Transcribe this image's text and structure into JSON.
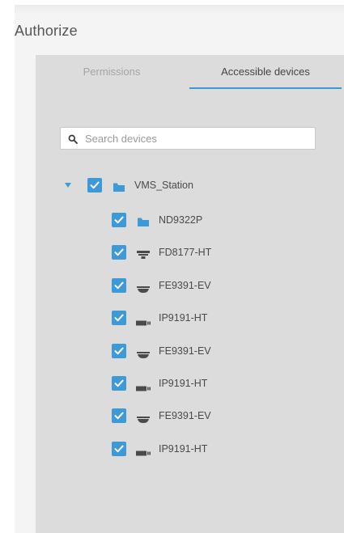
{
  "title": "Authorize",
  "tabs": {
    "permissions": "Permissions",
    "accessible_devices": "Accessible devices"
  },
  "search": {
    "placeholder": "Search devices",
    "value": ""
  },
  "colors": {
    "accent": "#3e9ad6",
    "panel": "#dcdcdc"
  },
  "tree": {
    "root": {
      "label": "VMS_Station",
      "icon": "folder-icon",
      "expanded": true,
      "checked": true
    },
    "children": [
      {
        "label": "ND9322P",
        "icon": "folder-icon",
        "checked": true
      },
      {
        "label": "FD8177-HT",
        "icon": "fixed-dome-camera-icon",
        "checked": true
      },
      {
        "label": "FE9391-EV",
        "icon": "fisheye-camera-icon",
        "checked": true
      },
      {
        "label": "IP9191-HT",
        "icon": "bullet-camera-icon",
        "checked": true
      },
      {
        "label": "FE9391-EV",
        "icon": "fisheye-camera-icon",
        "checked": true
      },
      {
        "label": "IP9191-HT",
        "icon": "bullet-camera-icon",
        "checked": true
      },
      {
        "label": "FE9391-EV",
        "icon": "fisheye-camera-icon",
        "checked": true
      },
      {
        "label": "IP9191-HT",
        "icon": "bullet-camera-icon",
        "checked": true
      }
    ]
  }
}
